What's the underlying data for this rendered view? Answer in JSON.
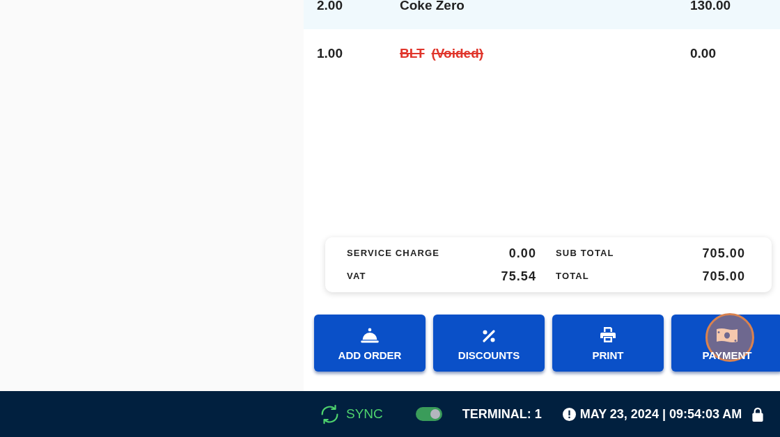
{
  "order_items": [
    {
      "quantity": "2.00",
      "name": "Coke Zero",
      "amount": "130.00",
      "selected": true,
      "voided": false
    },
    {
      "quantity": "1.00",
      "name": "BLT",
      "note": "(Voided)",
      "amount": "0.00",
      "selected": false,
      "voided": true
    }
  ],
  "summary": [
    {
      "label": "SERVICE CHARGE",
      "value": "0.00"
    },
    {
      "label": "SUB TOTAL",
      "value": "705.00"
    },
    {
      "label": "VAT",
      "value": "75.54"
    },
    {
      "label": "TOTAL",
      "value": "705.00"
    }
  ],
  "actions": [
    {
      "kind": "order",
      "label": "ADD ORDER",
      "highlighted": false
    },
    {
      "kind": "discount",
      "label": "DISCOUNTS",
      "highlighted": false
    },
    {
      "kind": "print",
      "label": "PRINT",
      "highlighted": false
    },
    {
      "kind": "payment",
      "label": "PAYMENT",
      "highlighted": true
    }
  ],
  "status_bar": {
    "sync": {
      "label": "SYNC"
    },
    "sync_toggle": {
      "on": true
    },
    "terminal": "TERMINAL: 1",
    "datetime": "MAY 23, 2024 | 09:54:03 AM"
  }
}
